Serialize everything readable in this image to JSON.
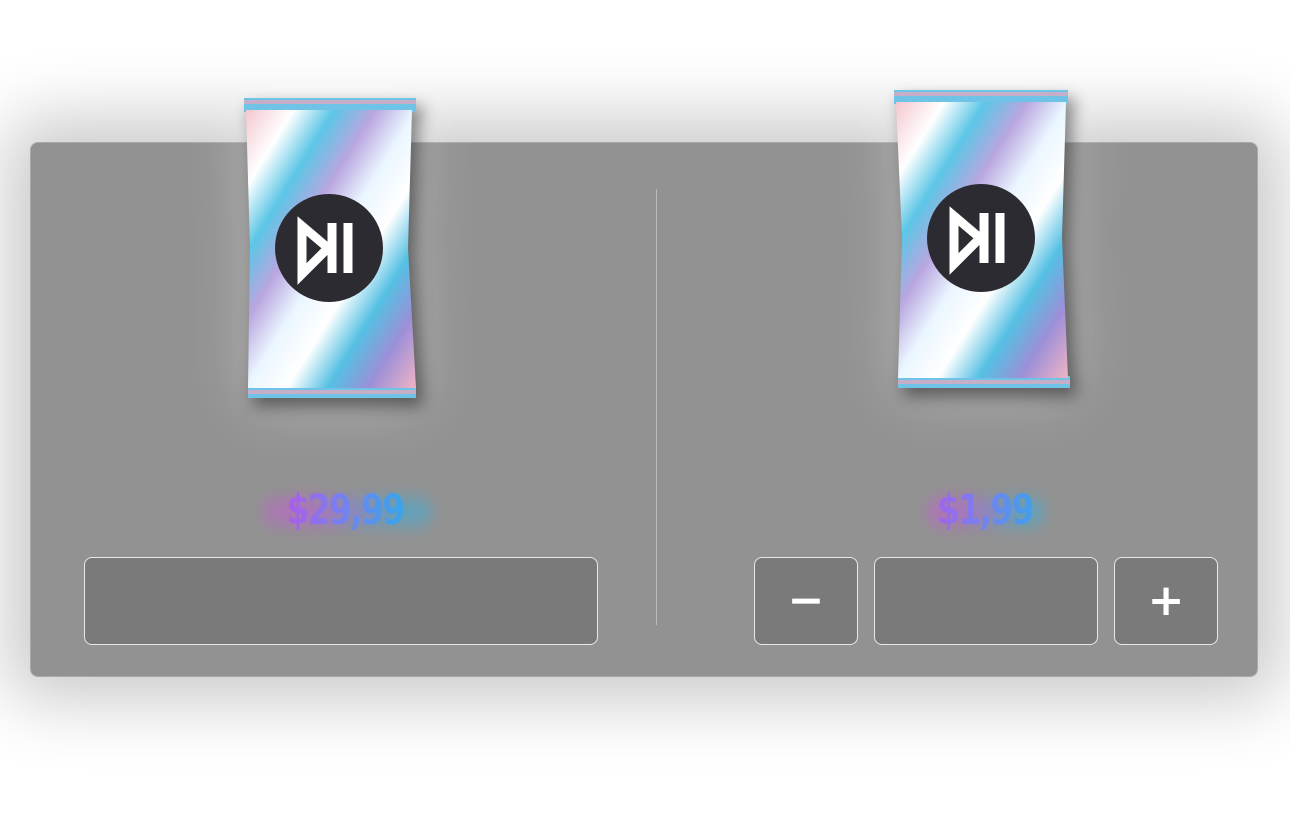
{
  "products": [
    {
      "price": "$29,99",
      "logo_icon": "mi-logo-icon",
      "buy_button_label": ""
    },
    {
      "price": "$1,99",
      "logo_icon": "mi-logo-icon",
      "quantity": {
        "decrement_label": "−",
        "value": "",
        "increment_label": "+"
      }
    }
  ],
  "colors": {
    "panel": "#929292",
    "button": "#7a7a7a",
    "button_border": "#e8e8e8",
    "price_gradient_start": "#c24ee0",
    "price_gradient_end": "#1fb3e8"
  }
}
